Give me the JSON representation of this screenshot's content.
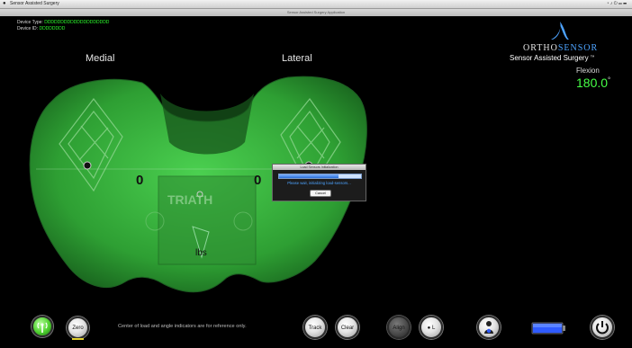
{
  "menubar": {
    "app_name": "Sensor Assisted Surgery"
  },
  "window": {
    "title": "Sensor Assisted Surgery Application"
  },
  "device": {
    "type_label": "Device Type:",
    "type_value": "DDDDDDDDDDDDDDDDDDDD",
    "id_label": "Device ID:",
    "id_value": "DDDDDDDD"
  },
  "labels": {
    "medial": "Medial",
    "lateral": "Lateral",
    "units": "lbs",
    "implant": "TRIATH"
  },
  "brand": {
    "ortho": "ORTHO",
    "sensor": "SENSOR",
    "subtitle": "Sensor Assisted Surgery",
    "tm": "TM",
    "accent": "#4da3ff"
  },
  "flexion": {
    "label": "Flexion",
    "value": "180.0",
    "unit": "°"
  },
  "loads": {
    "medial": "0",
    "lateral": "0"
  },
  "dialog": {
    "title": "Load Sensors Initialization",
    "message": "Please wait, initializing load-sensors...",
    "cancel_label": "Cancel",
    "progress": 0.72
  },
  "toolbar": {
    "zero_label": "Zero",
    "note": "Center of load and angle indicators are for reference only.",
    "track_label": "Track",
    "clear_label": "Clear",
    "align_label": "Align",
    "l_label": "L"
  },
  "colors": {
    "implant_green": "#35b23a",
    "value_green": "#46ff46",
    "battery_blue": "#2f5bff"
  },
  "icons": {
    "wireless": "wireless-icon",
    "person": "person-icon",
    "battery": "battery-icon",
    "power": "power-icon"
  }
}
